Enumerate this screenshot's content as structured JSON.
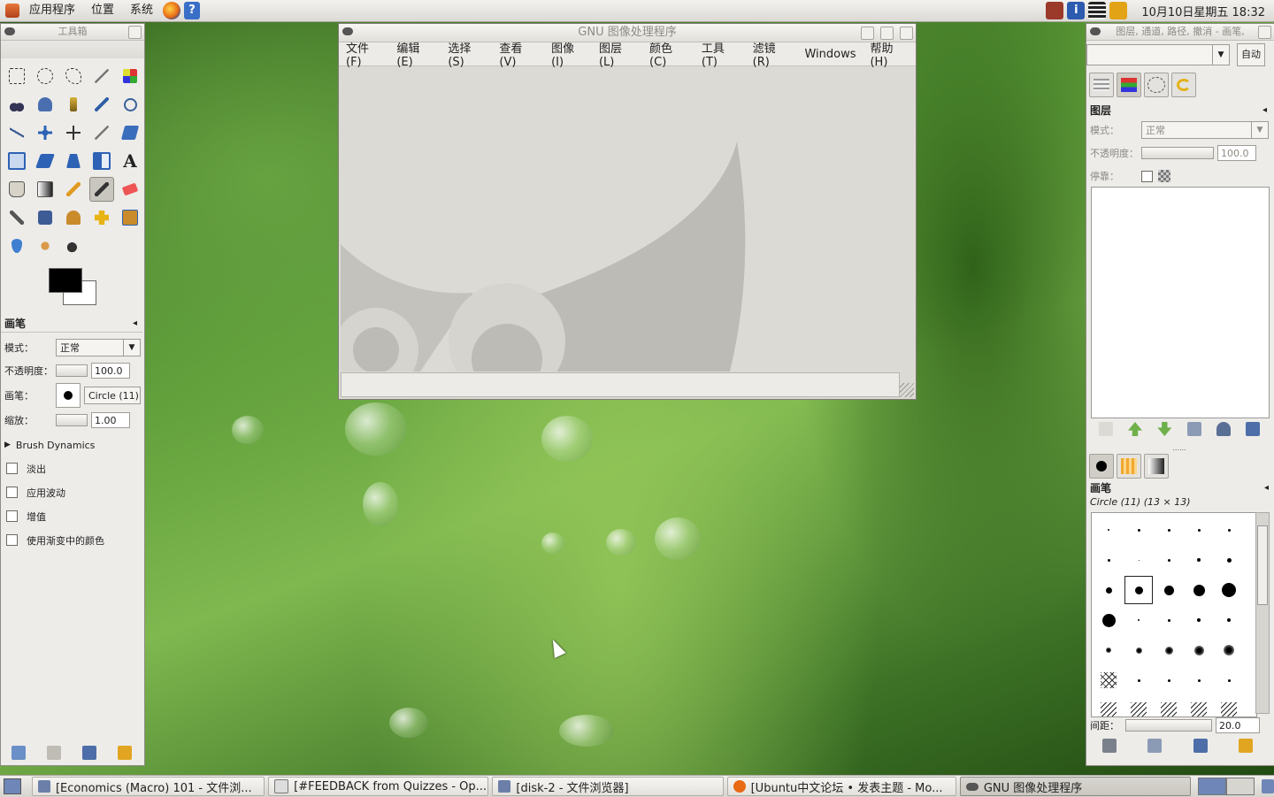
{
  "top_panel": {
    "menus": [
      "应用程序",
      "位置",
      "系统"
    ],
    "clock": "10月10日星期五 18:32"
  },
  "toolbox": {
    "title": "工具箱",
    "tool_options": {
      "heading": "画笔",
      "mode_label": "模式：",
      "mode_value": "正常",
      "opacity_label": "不透明度：",
      "opacity_value": "100.0",
      "brush_label": "画笔：",
      "brush_value": "Circle (11)",
      "scale_label": "缩放：",
      "scale_value": "1.00",
      "dynamics_label": "Brush Dynamics",
      "checks": [
        "淡出",
        "应用波动",
        "增值",
        "使用渐变中的颜色"
      ]
    }
  },
  "image_window": {
    "title": "GNU 图像处理程序",
    "menus": [
      "文件(F)",
      "编辑(E)",
      "选择(S)",
      "查看(V)",
      "图像(I)",
      "图层(L)",
      "颜色(C)",
      "工具(T)",
      "滤镜(R)",
      "Windows",
      "帮助(H)"
    ]
  },
  "right_dock": {
    "title": "图层, 通道, 路径, 撤消 - 画笔,",
    "auto_button": "自动",
    "layers": {
      "heading": "图层",
      "mode_label": "模式：",
      "mode_value": "正常",
      "opacity_label": "不透明度：",
      "opacity_value": "100.0",
      "lock_label": "停靠："
    },
    "brushes": {
      "heading": "画笔",
      "selected": "Circle (11) (13 × 13)",
      "spacing_label": "间距：",
      "spacing_value": "20.0"
    }
  },
  "taskbar": {
    "tasks": [
      "[Economics (Macro) 101 - 文件浏...",
      "[#FEEDBACK from Quizzes - Op...",
      "[disk-2 - 文件浏览器]",
      "[Ubuntu中文论坛 • 发表主题 - Mo...",
      "GNU 图像处理程序"
    ]
  },
  "colors": {
    "panel_bg": "#dcdad5",
    "wallpaper": "#5f9e3a"
  }
}
